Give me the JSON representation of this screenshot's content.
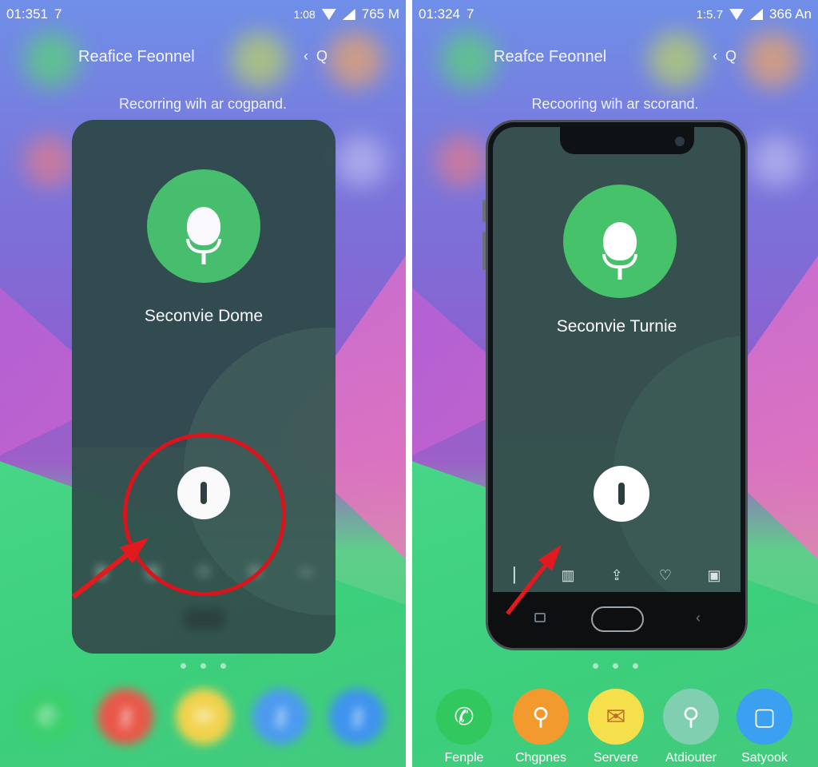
{
  "left": {
    "status": {
      "time": "01:351",
      "extra": "7",
      "right_text": "765 M",
      "small": "1:08"
    },
    "header": {
      "title": "Reafice Feonnel",
      "back_icon": "‹",
      "search_icon": "Q"
    },
    "subtitle": "Recorring wih ar cogpand.",
    "device_name": "Seconvie Dome",
    "dock": [
      {
        "label": "",
        "color": "#3ccf6e",
        "icon": "phone-icon"
      },
      {
        "label": "",
        "color": "#e9584a",
        "icon": "key-icon"
      },
      {
        "label": "",
        "color": "#f2d24c",
        "icon": "mail-icon"
      },
      {
        "label": "",
        "color": "#4c9af0",
        "icon": "key-icon"
      },
      {
        "label": "",
        "color": "#3f93ee",
        "icon": "key-icon"
      }
    ]
  },
  "right": {
    "status": {
      "time": "01:324",
      "extra": "7",
      "small": "1:5.7",
      "right_text": "366 An"
    },
    "header": {
      "title": "Reafce Feonnel",
      "back_icon": "‹",
      "search_icon": "Q"
    },
    "subtitle": "Recooring wih ar scorand.",
    "device_name": "Seconvie Turnie",
    "dock": [
      {
        "label": "Fenple",
        "color": "#31c95e",
        "icon": "phone-icon"
      },
      {
        "label": "Chgpnes",
        "color": "#f39a2f",
        "icon": "key-icon"
      },
      {
        "label": "Servere",
        "color": "#f5df4b",
        "icon": "mail-icon"
      },
      {
        "label": "Atdiouter",
        "color": "#7fcfb0",
        "icon": "key-icon"
      },
      {
        "label": "Satyook",
        "color": "#3aa0ef",
        "icon": "chat-icon"
      }
    ]
  },
  "colors": {
    "accent_green": "#45c26a",
    "highlight_red": "#d8141c"
  }
}
